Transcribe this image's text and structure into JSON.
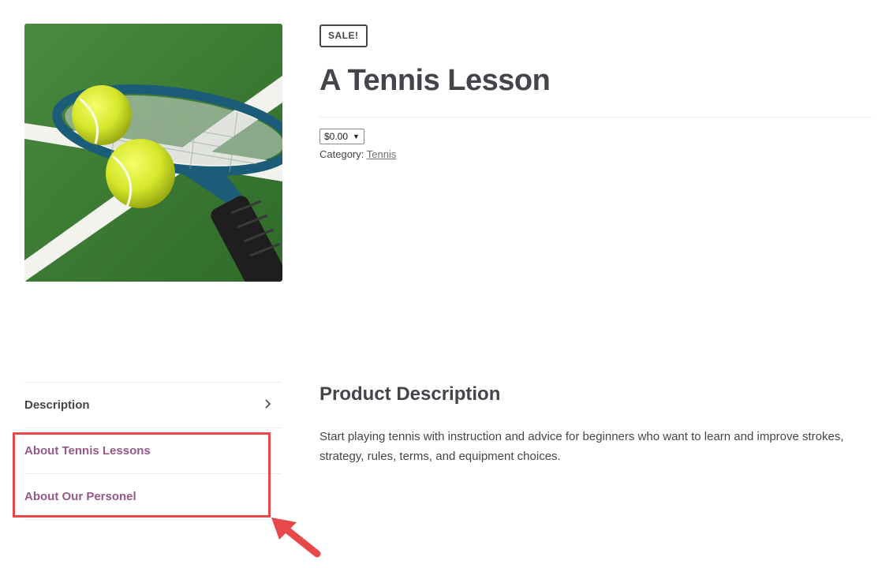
{
  "product": {
    "badge": "SALE!",
    "title": "A Tennis Lesson",
    "price_selected": "$0.00",
    "category_label": "Category:",
    "category_link": "Tennis",
    "image_icon": "tennis-racket-and-balls-photo"
  },
  "tabs": [
    {
      "label": "Description",
      "active": true
    },
    {
      "label": "About Tennis Lessons",
      "active": false
    },
    {
      "label": "About Our Personel",
      "active": false
    }
  ],
  "panel": {
    "heading": "Product Description",
    "text": "Start playing tennis with instruction and advice for beginners who want to learn and improve strokes, strategy, rules, terms, and equipment choices."
  },
  "colors": {
    "text": "#43454b",
    "tab_link": "#96588a",
    "highlight": "#e9484b",
    "court_green": "#3f7a36"
  }
}
